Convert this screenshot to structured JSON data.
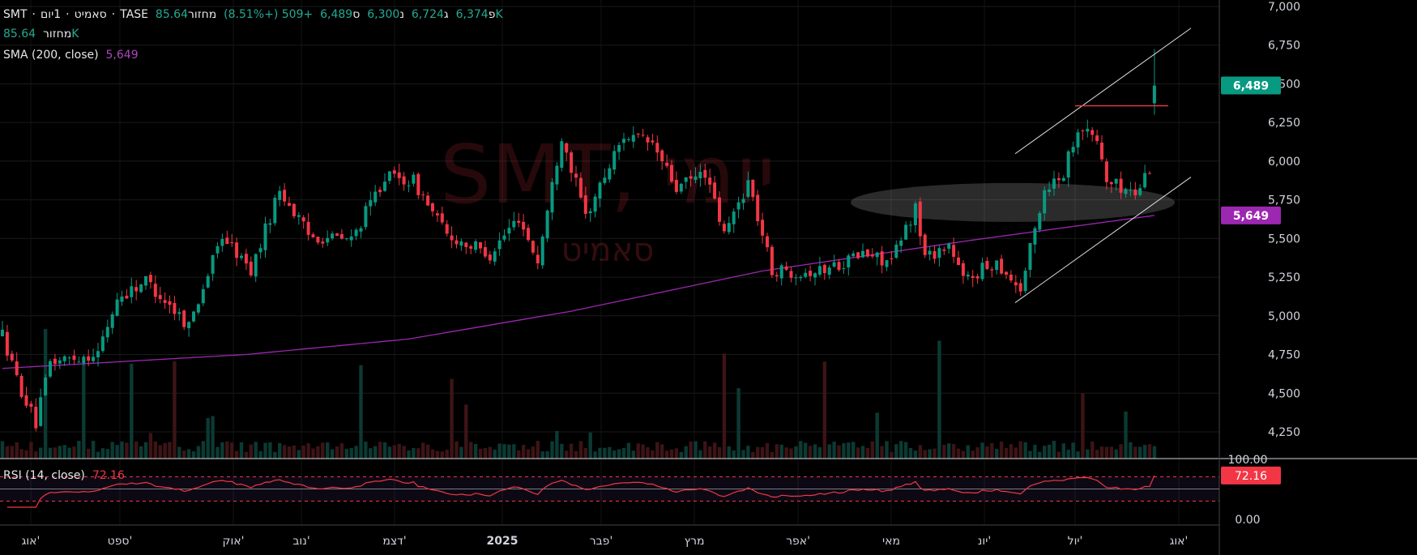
{
  "header": {
    "symbol": "SMT",
    "name": "סאמיט",
    "interval": "1יום",
    "exchange": "TASE",
    "open_label": "פ",
    "open": "6,374",
    "high_label": "ג",
    "high": "6,724",
    "low_label": "נ",
    "low": "6,300",
    "close_label": "ס",
    "close": "6,489",
    "change": "+509 (+8.51%)",
    "volume_label": "מחזור",
    "volume_value": "85.64K"
  },
  "volume_legend": {
    "label": "מחזור",
    "value": "85.64K"
  },
  "sma_legend": {
    "label": "SMA (200, close)",
    "value": "5,649"
  },
  "rsi_legend": {
    "label": "RSI (14, close)",
    "value": "72.16"
  },
  "watermark": {
    "title": "SMT, יומי",
    "subtitle": "סאמיט"
  },
  "colors": {
    "up": "#089981",
    "down": "#f23645",
    "sma": "#9c27b0",
    "rsi": "#f23645",
    "background": "#000000"
  },
  "chart_data": {
    "type": "candlestick",
    "title": "SMT · סאמיט · 1יום · TASE",
    "price_axis": {
      "ticks": [
        "7,000",
        "6,750",
        "6,500",
        "6,250",
        "6,000",
        "5,750",
        "5,500",
        "5,250",
        "5,000",
        "4,750",
        "4,500",
        "4,250"
      ],
      "range": [
        4250,
        7000
      ]
    },
    "price_labels": {
      "last": "6,489",
      "sma": "5,649"
    },
    "time_axis": [
      "אוג'",
      "ספט'",
      "אוק'",
      "נוב'",
      "דצמ'",
      "2025",
      "פבר'",
      "מרץ",
      "אפר'",
      "מאי",
      "יונ'",
      "יול'",
      "אוג'"
    ],
    "bar_count": 242,
    "close_path": [
      [
        0,
        4880
      ],
      [
        3,
        4590
      ],
      [
        7,
        4300
      ],
      [
        10,
        4700
      ],
      [
        20,
        4760
      ],
      [
        24,
        5110
      ],
      [
        30,
        5230
      ],
      [
        39,
        4940
      ],
      [
        46,
        5520
      ],
      [
        52,
        5290
      ],
      [
        58,
        5820
      ],
      [
        64,
        5520
      ],
      [
        73,
        5490
      ],
      [
        80,
        5900
      ],
      [
        86,
        5870
      ],
      [
        93,
        5520
      ],
      [
        102,
        5400
      ],
      [
        108,
        5640
      ],
      [
        112,
        5350
      ],
      [
        117,
        6170
      ],
      [
        122,
        5640
      ],
      [
        130,
        6170
      ],
      [
        136,
        6110
      ],
      [
        141,
        5820
      ],
      [
        147,
        5930
      ],
      [
        151,
        5520
      ],
      [
        156,
        5870
      ],
      [
        161,
        5290
      ],
      [
        171,
        5290
      ],
      [
        180,
        5400
      ],
      [
        186,
        5350
      ],
      [
        191,
        5700
      ],
      [
        193,
        5380
      ],
      [
        198,
        5460
      ],
      [
        201,
        5230
      ],
      [
        208,
        5350
      ],
      [
        213,
        5170
      ],
      [
        218,
        5820
      ],
      [
        222,
        5930
      ],
      [
        225,
        6230
      ],
      [
        229,
        6140
      ],
      [
        231,
        5870
      ],
      [
        237,
        5790
      ],
      [
        240,
        5960
      ]
    ],
    "last_bar": {
      "open": 6374,
      "high": 6724,
      "low": 6300,
      "close": 6489,
      "volume": "85.64K"
    },
    "sma_200_path": [
      [
        0,
        4660
      ],
      [
        51,
        4750
      ],
      [
        85,
        4850
      ],
      [
        119,
        5030
      ],
      [
        159,
        5290
      ],
      [
        203,
        5490
      ],
      [
        241,
        5649
      ]
    ],
    "rsi": {
      "period": 14,
      "last": 72.16,
      "levels": [
        70,
        50,
        30
      ],
      "axis_ticks": [
        "100.00",
        "0.00"
      ],
      "range": [
        0,
        100
      ]
    }
  }
}
